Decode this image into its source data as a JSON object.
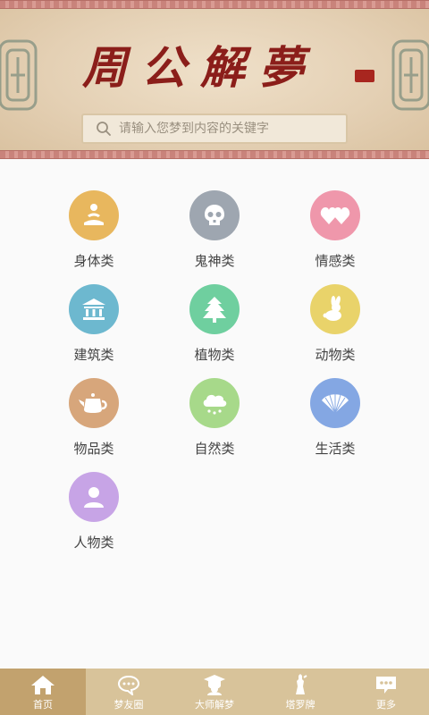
{
  "header": {
    "title": "周公解夢",
    "search_placeholder": "请输入您梦到内容的关键字"
  },
  "categories": [
    {
      "label": "身体类",
      "icon": "meditation-icon",
      "color": "#e8b75e"
    },
    {
      "label": "鬼神类",
      "icon": "skull-icon",
      "color": "#9ea6b0"
    },
    {
      "label": "情感类",
      "icon": "hearts-icon",
      "color": "#ef97ab"
    },
    {
      "label": "建筑类",
      "icon": "building-icon",
      "color": "#6db8cf"
    },
    {
      "label": "植物类",
      "icon": "tree-icon",
      "color": "#6fcf9f"
    },
    {
      "label": "动物类",
      "icon": "rabbit-icon",
      "color": "#e9d36a"
    },
    {
      "label": "物品类",
      "icon": "teapot-icon",
      "color": "#d7a67b"
    },
    {
      "label": "自然类",
      "icon": "cloud-rain-icon",
      "color": "#a7d98a"
    },
    {
      "label": "生活类",
      "icon": "fan-icon",
      "color": "#84a7e3"
    },
    {
      "label": "人物类",
      "icon": "person-icon",
      "color": "#c7a4e6"
    }
  ],
  "tabs": [
    {
      "label": "首页",
      "icon": "home-icon",
      "active": true
    },
    {
      "label": "梦友圈",
      "icon": "chat-bubble-icon",
      "active": false
    },
    {
      "label": "大师解梦",
      "icon": "master-icon",
      "active": false
    },
    {
      "label": "塔罗牌",
      "icon": "tarot-icon",
      "active": false
    },
    {
      "label": "更多",
      "icon": "more-icon",
      "active": false
    }
  ]
}
